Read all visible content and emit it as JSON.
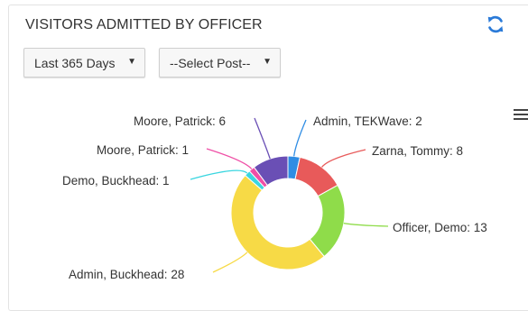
{
  "widget": {
    "title": "VISITORS ADMITTED BY OFFICER",
    "refresh_icon": "refresh-icon",
    "menu_icon": "hamburger-menu-icon"
  },
  "filters": {
    "range": {
      "selected": "Last 365 Days"
    },
    "post": {
      "selected": "--Select Post--"
    }
  },
  "chart_data": {
    "type": "pie",
    "donut": true,
    "slices": [
      {
        "label": "Admin, TEKWave: 2",
        "name": "Admin, TEKWave",
        "value": 2,
        "color": "#2f8de4"
      },
      {
        "label": "Zarna, Tommy: 8",
        "name": "Zarna, Tommy",
        "value": 8,
        "color": "#e85a5a"
      },
      {
        "label": "Officer, Demo: 13",
        "name": "Officer, Demo",
        "value": 13,
        "color": "#8fdc4a"
      },
      {
        "label": "Admin, Buckhead: 28",
        "name": "Admin, Buckhead",
        "value": 28,
        "color": "#f7da46"
      },
      {
        "label": "Demo, Buckhead: 1",
        "name": "Demo, Buckhead",
        "value": 1,
        "color": "#3ad6e0"
      },
      {
        "label": "Moore, Patrick: 1",
        "name": "Moore, Patrick",
        "value": 1,
        "color": "#ef4fa6"
      },
      {
        "label": "Moore, Patrick: 6",
        "name": "Moore, Patrick",
        "value": 6,
        "color": "#6a4fb5"
      }
    ]
  }
}
